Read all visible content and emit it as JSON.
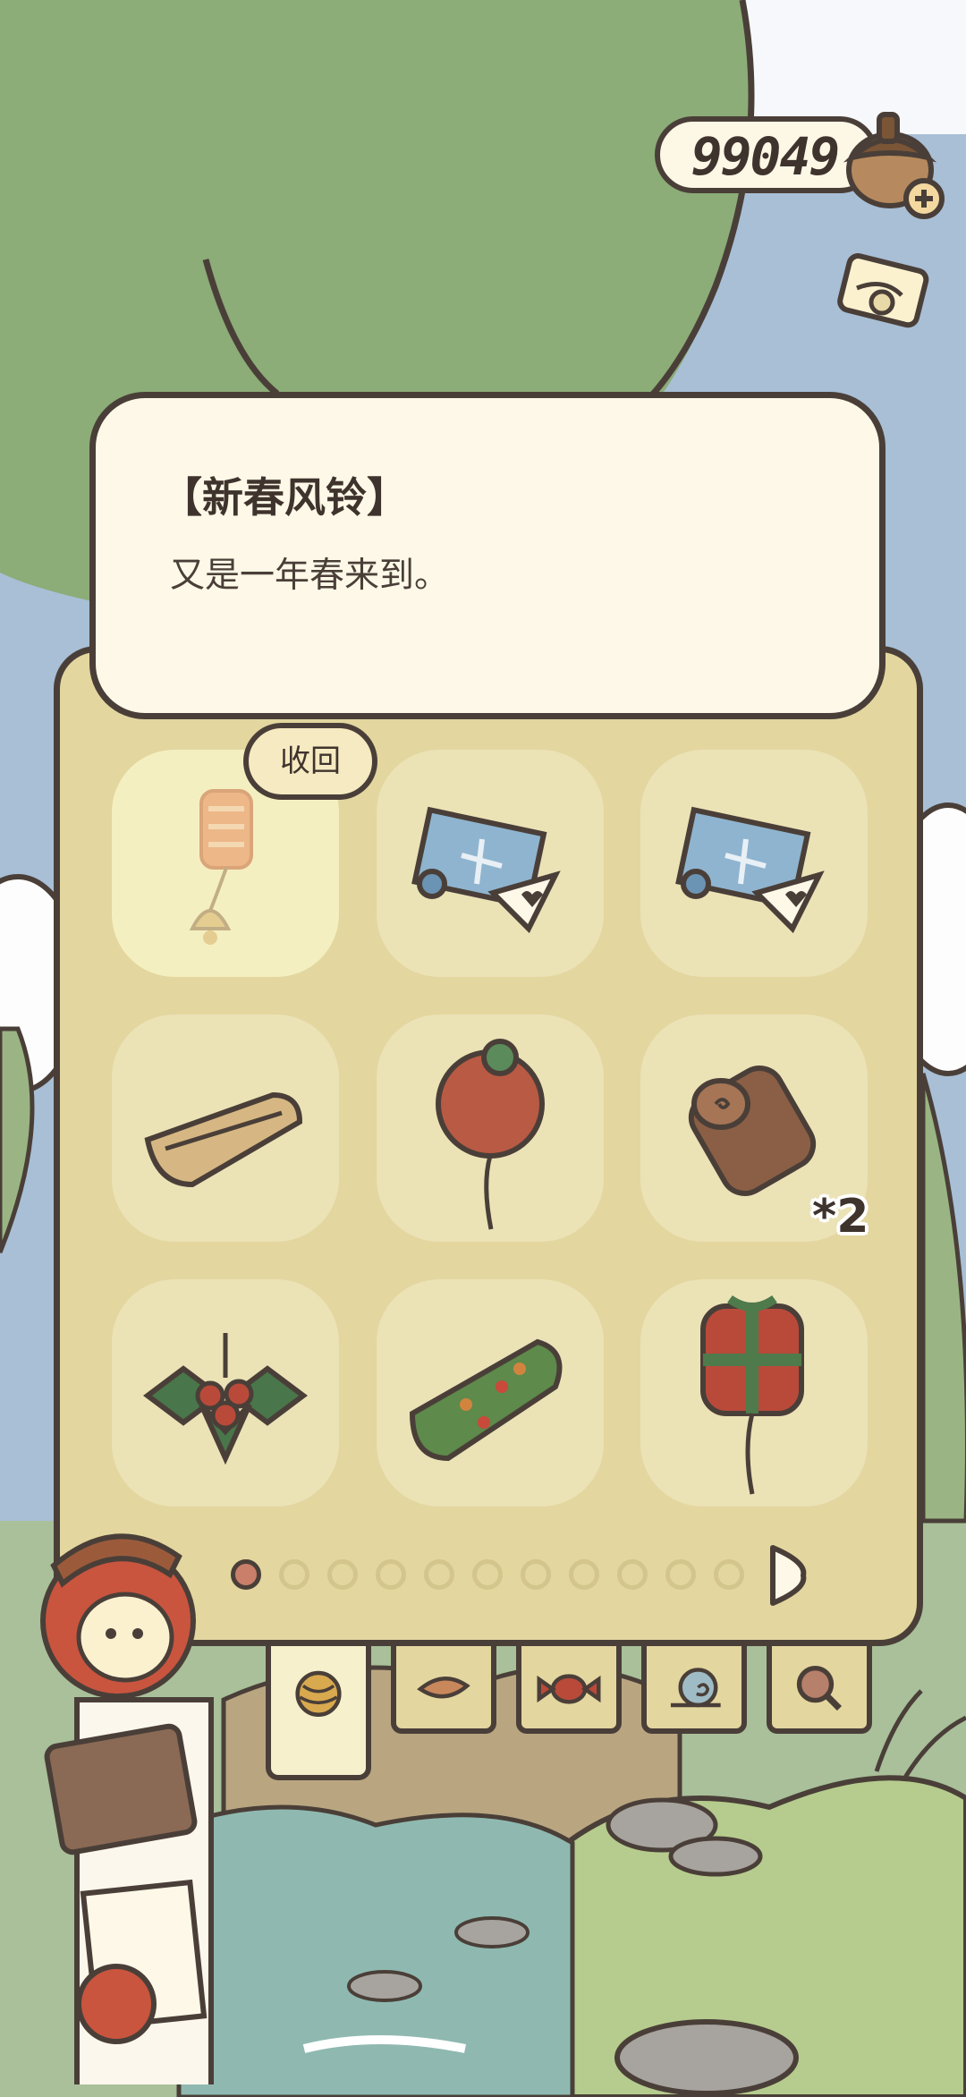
{
  "currency": {
    "clover_count": "99049",
    "icon": "acorn-plus-icon"
  },
  "popup": {
    "title": "【新春风铃】",
    "description": "又是一年春来到。"
  },
  "recall_button": {
    "label": "收回"
  },
  "inventory": {
    "slots": [
      {
        "item": "new-year-wind-chime",
        "selected": true
      },
      {
        "item": "blue-map-scroll-with-ticket"
      },
      {
        "item": "blue-map-scroll-with-ticket"
      },
      {
        "item": "folded-blanket"
      },
      {
        "item": "red-balloon"
      },
      {
        "item": "wooden-log"
      },
      {
        "item": "holly-berries"
      },
      {
        "item": "green-roll-cake"
      },
      {
        "item": "gift-box-balloon"
      }
    ],
    "log_count": "*2"
  },
  "pagination": {
    "total_pages": 11,
    "current_page": 1
  },
  "tabs": [
    {
      "icon": "yarn-ball-icon",
      "active": true
    },
    {
      "icon": "leaf-icon"
    },
    {
      "icon": "candy-icon"
    },
    {
      "icon": "snail-shell-icon"
    },
    {
      "icon": "magnifier-icon"
    }
  ],
  "colors": {
    "outline": "#4a3f38",
    "panel": "#e3d69f",
    "slot": "#ebe2b6",
    "popup": "#fdf8e7",
    "accent": "#c97f6a"
  }
}
